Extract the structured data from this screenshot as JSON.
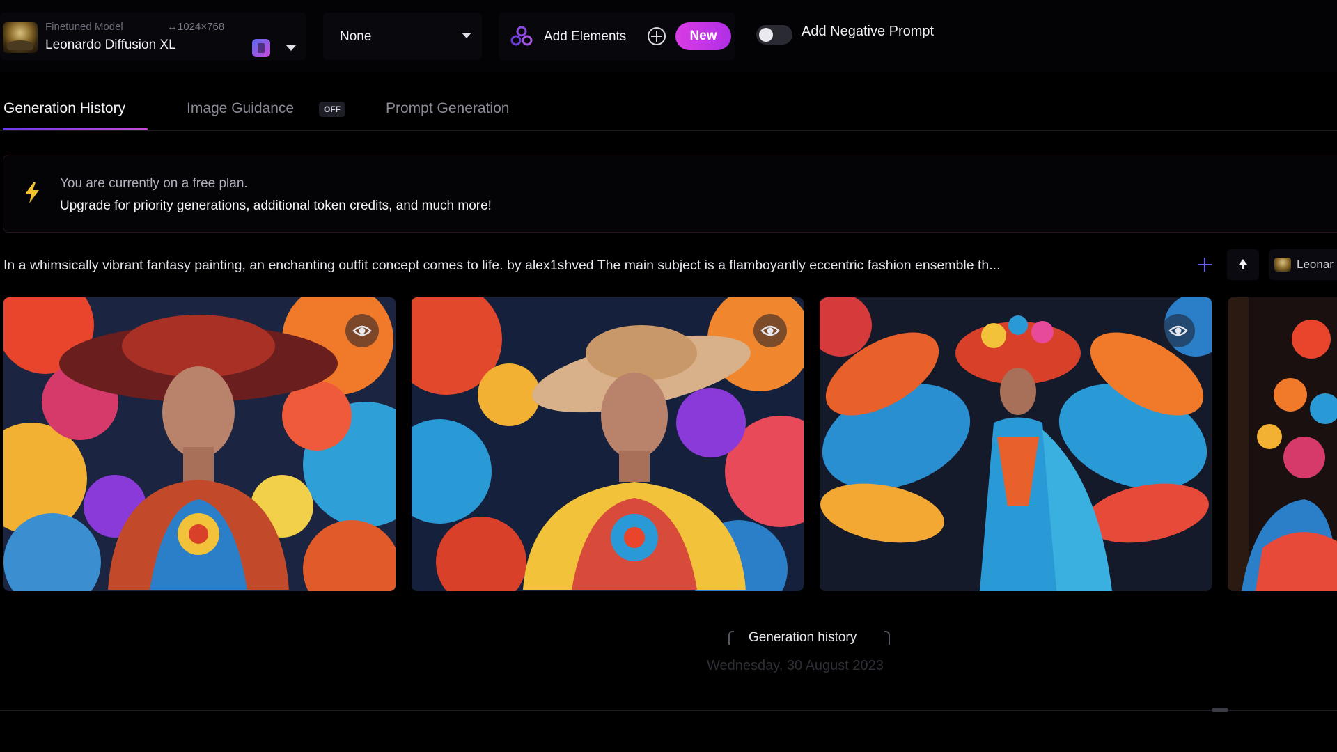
{
  "model": {
    "sub_label": "Finetuned Model",
    "resolution": "↔1024×768",
    "name": "Leonardo Diffusion XL"
  },
  "style_select": {
    "value": "None"
  },
  "elements": {
    "label": "Add Elements",
    "badge": "New"
  },
  "negative_prompt": {
    "label": "Add Negative Prompt",
    "enabled": false
  },
  "tabs": [
    {
      "label": "Generation History",
      "active": true
    },
    {
      "label": "Image Guidance",
      "badge": "OFF"
    },
    {
      "label": "Prompt Generation"
    }
  ],
  "notice": {
    "line1": "You are currently on a free plan.",
    "line2": "Upgrade for priority generations, additional token credits, and much more!"
  },
  "prompt": {
    "text": "In a whimsically vibrant fantasy painting, an enchanting outfit concept comes to life. by alex1shved The main subject is a flamboyantly eccentric fashion ensemble th...",
    "model_chip": "Leonar"
  },
  "images": [
    {
      "icon": "eye-icon"
    },
    {
      "icon": "eye-icon"
    },
    {
      "icon": "eye-icon"
    },
    {
      "icon": "eye-icon"
    }
  ],
  "footer": {
    "history_label": "Generation history",
    "date": "Wednesday, 30 August 2023"
  },
  "colors": {
    "accent_purple": "#c94bd8",
    "new_badge": "#d93ce4",
    "background": "#000000"
  }
}
